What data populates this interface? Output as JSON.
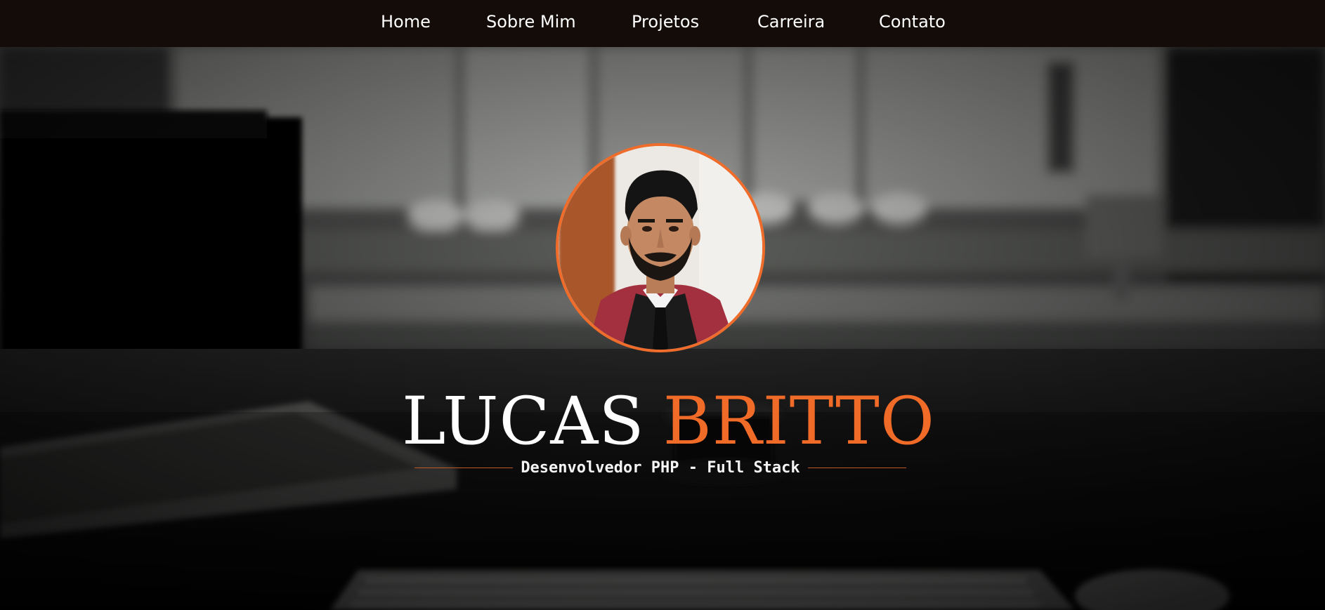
{
  "nav": {
    "items": [
      {
        "label": "Home"
      },
      {
        "label": "Sobre Mim"
      },
      {
        "label": "Projetos"
      },
      {
        "label": "Carreira"
      },
      {
        "label": "Contato"
      }
    ]
  },
  "hero": {
    "first_name": "LUCAS",
    "last_name": "BRITTO",
    "subtitle": "Desenvolvedor PHP - Full Stack"
  },
  "colors": {
    "accent": "#f06a28",
    "nav_background": "#130c08",
    "text": "#ffffff"
  },
  "icons": {
    "avatar": "profile-photo"
  }
}
